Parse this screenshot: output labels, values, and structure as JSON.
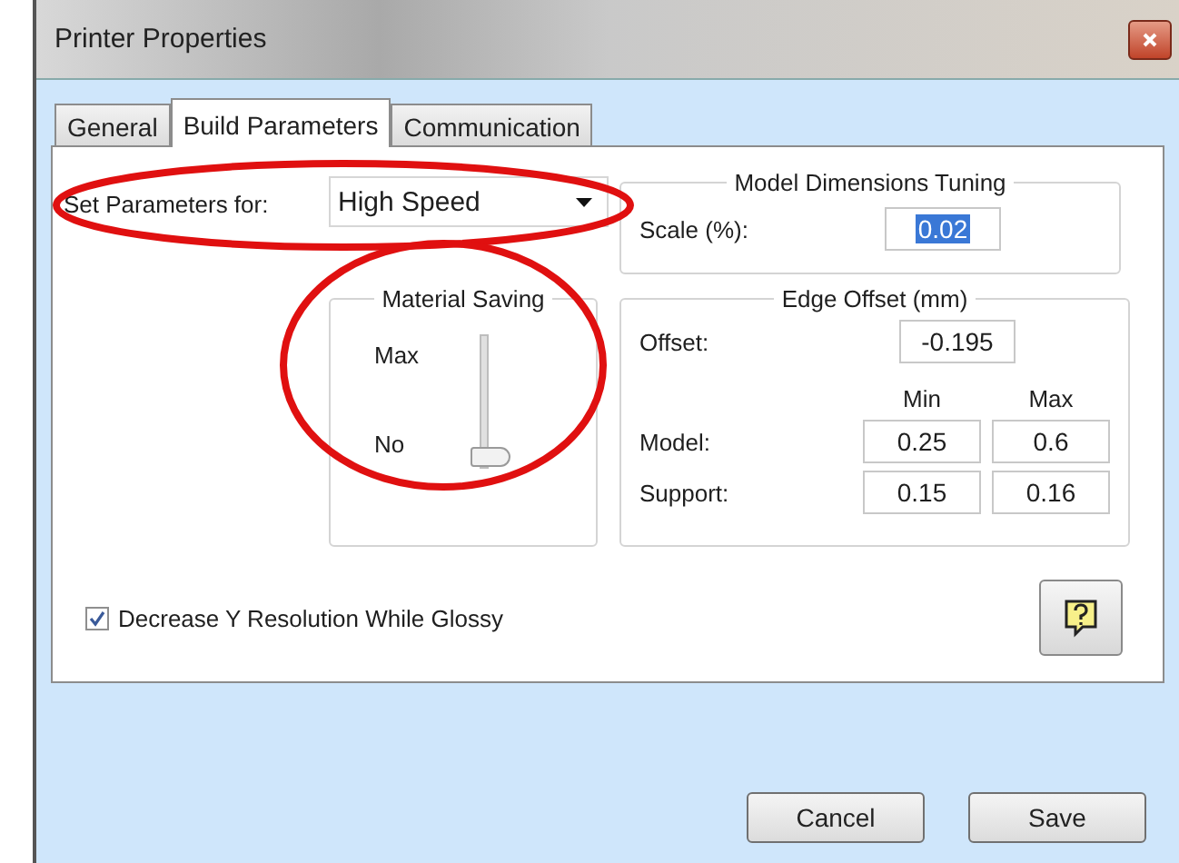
{
  "window": {
    "title": "Printer Properties"
  },
  "tabs": [
    {
      "label": "General",
      "selected": false
    },
    {
      "label": "Build Parameters",
      "selected": true
    },
    {
      "label": "Communication",
      "selected": false
    }
  ],
  "set_parameters": {
    "label": "Set Parameters for:",
    "value": "High Speed"
  },
  "model_dimensions": {
    "title": "Model Dimensions Tuning",
    "scale_label": "Scale (%):",
    "scale_value": "0.02"
  },
  "material_saving": {
    "title": "Material Saving",
    "max_label": "Max",
    "min_label": "No",
    "level": 0
  },
  "edge_offset": {
    "title": "Edge Offset (mm)",
    "offset_label": "Offset:",
    "offset_value": "-0.195",
    "columns": [
      "Min",
      "Max"
    ],
    "rows": [
      {
        "label": "Model:",
        "min": "0.25",
        "max": "0.6"
      },
      {
        "label": "Support:",
        "min": "0.15",
        "max": "0.16"
      }
    ]
  },
  "decrease_y": {
    "label": "Decrease Y Resolution While Glossy",
    "checked": true
  },
  "buttons": [
    "Cancel",
    "Save"
  ]
}
